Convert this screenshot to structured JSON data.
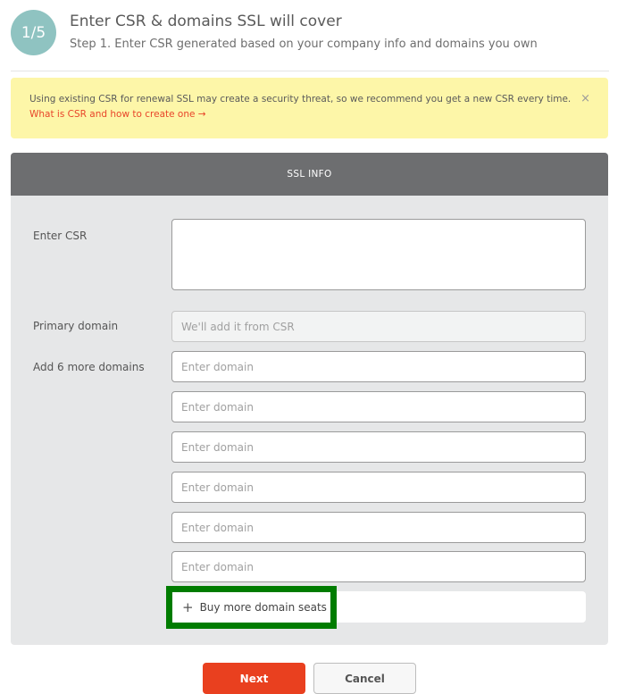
{
  "header": {
    "step_badge": "1/5",
    "title": "Enter CSR & domains SSL will cover",
    "subtitle": "Step 1. Enter CSR generated based on your company info and domains you own"
  },
  "alert": {
    "message": "Using existing CSR for renewal SSL may create a security threat, so we recommend you get a new CSR every time.",
    "link_label": "What is CSR and how to create one →",
    "close_glyph": "×"
  },
  "panel": {
    "title": "SSL INFO",
    "csr": {
      "label": "Enter CSR",
      "value": ""
    },
    "primary_domain": {
      "label": "Primary domain",
      "placeholder": "We'll add it from CSR"
    },
    "additional_domains": {
      "label": "Add 6 more domains",
      "fields": [
        {
          "placeholder": "Enter domain",
          "value": ""
        },
        {
          "placeholder": "Enter domain",
          "value": ""
        },
        {
          "placeholder": "Enter domain",
          "value": ""
        },
        {
          "placeholder": "Enter domain",
          "value": ""
        },
        {
          "placeholder": "Enter domain",
          "value": ""
        },
        {
          "placeholder": "Enter domain",
          "value": ""
        }
      ]
    },
    "buy_more": {
      "icon": "+",
      "label": "Buy more domain seats"
    }
  },
  "actions": {
    "next_label": "Next",
    "cancel_label": "Cancel"
  },
  "colors": {
    "accent": "#e9401f",
    "badge": "#8fc3c1",
    "alert_bg": "#fdf6a8",
    "panel_header": "#6d6e70",
    "highlight": "#007c00"
  }
}
